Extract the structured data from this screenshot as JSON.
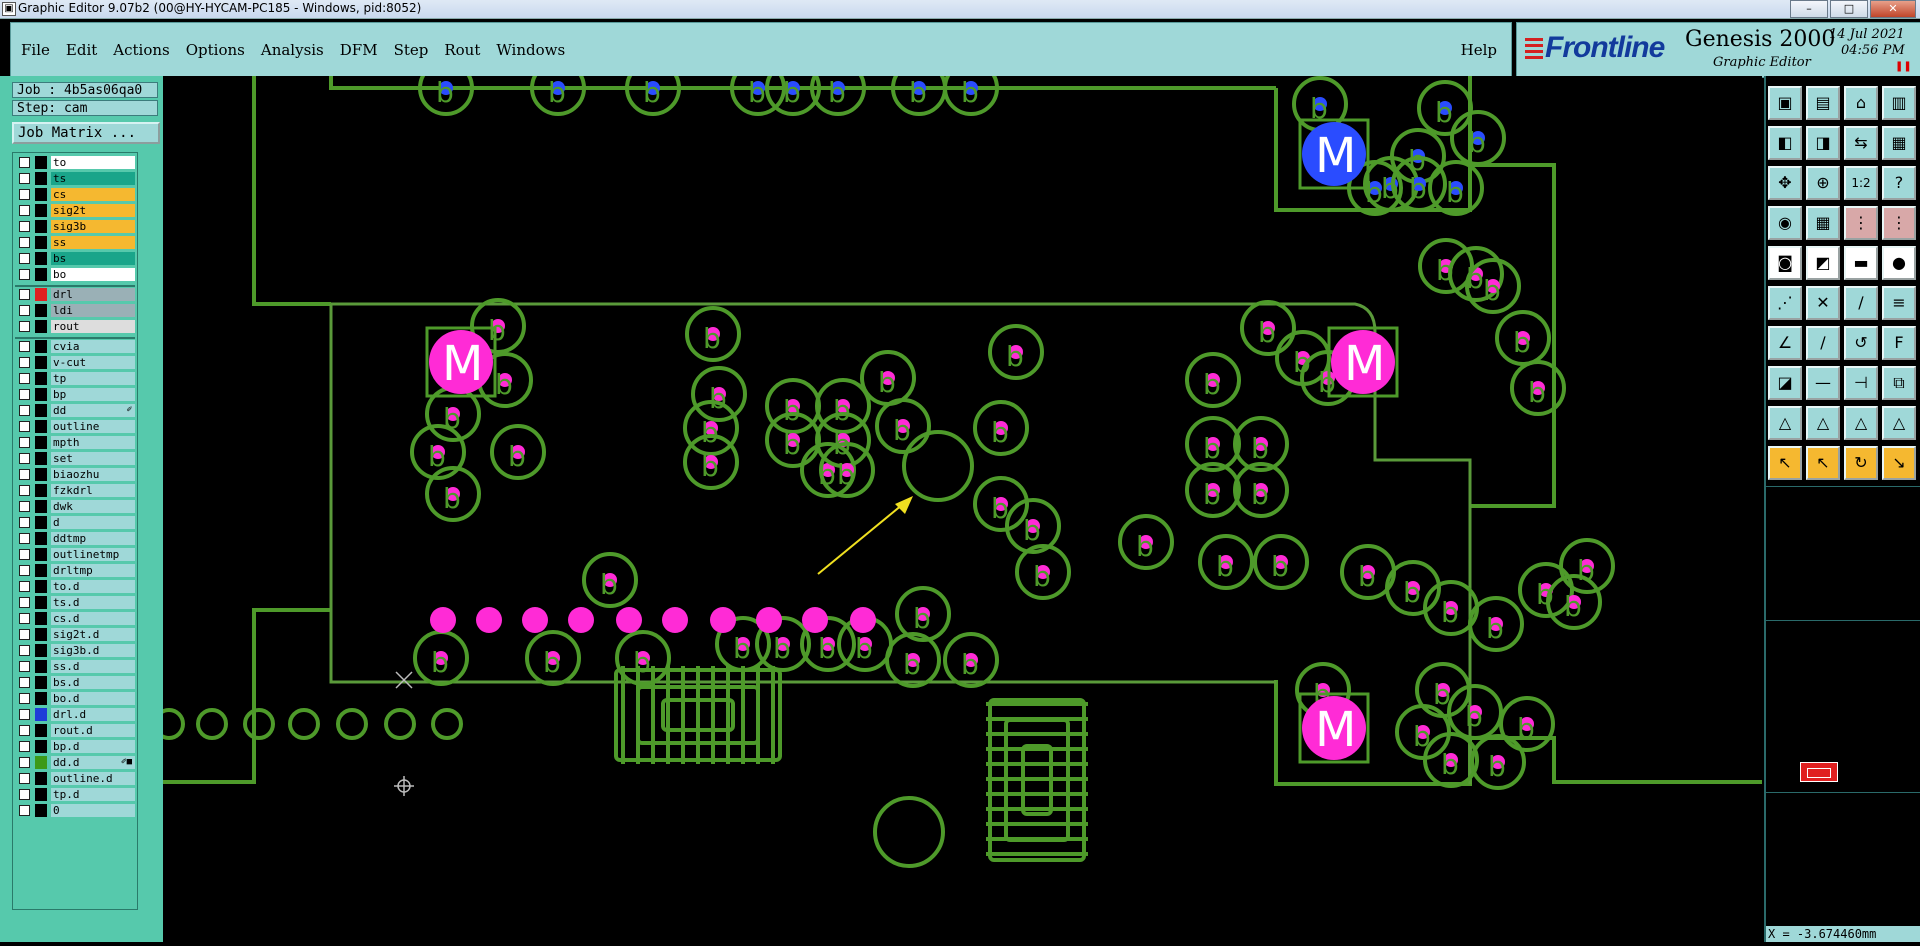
{
  "window": {
    "title": "Graphic Editor 9.07b2 (00@HY-HYCAM-PC185 - Windows, pid:8052)"
  },
  "menubar": {
    "items": [
      "File",
      "Edit",
      "Actions",
      "Options",
      "Analysis",
      "DFM",
      "Step",
      "Rout",
      "Windows"
    ],
    "help": "Help"
  },
  "brand": {
    "logo": "Frontline",
    "product": "Genesis 2000",
    "subtitle": "Graphic Editor",
    "date": "14 Jul 2021",
    "time": "04:56 PM"
  },
  "job": {
    "job_line": "Job : 4b5as06qa0",
    "step_line": "Step: cam",
    "matrix_button": "Job Matrix ..."
  },
  "layers": {
    "board": [
      {
        "name": "to",
        "color": "#ffffff"
      },
      {
        "name": "ts",
        "color": "#1aa58a"
      },
      {
        "name": "cs",
        "color": "#f5b830"
      },
      {
        "name": "sig2t",
        "color": "#f5b830"
      },
      {
        "name": "sig3b",
        "color": "#f5b830"
      },
      {
        "name": "ss",
        "color": "#f5b830"
      },
      {
        "name": "bs",
        "color": "#1aa58a"
      },
      {
        "name": "bo",
        "color": "#ffffff"
      }
    ],
    "drill": [
      {
        "name": "drl",
        "color": "#9ab0b6",
        "swatch": "#e02020"
      },
      {
        "name": "ldi",
        "color": "#9ab0b6"
      },
      {
        "name": "rout",
        "color": "#dddddd"
      }
    ],
    "misc": [
      {
        "name": "cvia"
      },
      {
        "name": "v-cut"
      },
      {
        "name": "tp"
      },
      {
        "name": "bp"
      },
      {
        "name": "dd",
        "mark": "✐"
      },
      {
        "name": "outline"
      },
      {
        "name": "mpth"
      },
      {
        "name": "set"
      },
      {
        "name": "biaozhu"
      },
      {
        "name": "fzkdrl"
      },
      {
        "name": "dwk"
      },
      {
        "name": "d"
      },
      {
        "name": "ddtmp"
      },
      {
        "name": "outlinetmp"
      },
      {
        "name": "drltmp"
      },
      {
        "name": "to.d"
      },
      {
        "name": "ts.d"
      },
      {
        "name": "cs.d"
      },
      {
        "name": "sig2t.d"
      },
      {
        "name": "sig3b.d"
      },
      {
        "name": "ss.d"
      },
      {
        "name": "bs.d"
      },
      {
        "name": "bo.d"
      },
      {
        "name": "drl.d",
        "swatch": "#1e3cd8"
      },
      {
        "name": "rout.d"
      },
      {
        "name": "bp.d"
      },
      {
        "name": "dd.d",
        "swatch": "#3c9a18",
        "mark": "✐■"
      },
      {
        "name": "outline.d"
      },
      {
        "name": "tp.d"
      },
      {
        "name": "0"
      }
    ]
  },
  "canvas": {
    "track_color": "#4e9a2a",
    "pad_color": "#ff2bd6",
    "via_color": "#2a4cff",
    "arrow_color": "#f0e020",
    "mounting_label": "M",
    "pad_label": "b"
  },
  "toolbar": {
    "icons": [
      "open-icon",
      "save-icon",
      "home-icon",
      "window-icon",
      "load-icon",
      "export-icon",
      "swap-icon",
      "panes-icon",
      "fit-icon",
      "zoom-icon",
      "scale-icon",
      "help-icon",
      "snap-icon",
      "grid-icon",
      "layers-icon",
      "layers2-icon",
      "select-icon",
      "draw-icon",
      "measure-icon",
      "pad-icon",
      "node-icon",
      "cross-icon",
      "line-icon",
      "text-icon",
      "angle-icon",
      "slope-icon",
      "arc-icon",
      "font-icon",
      "shape-icon",
      "horiz-icon",
      "fork-icon",
      "group-icon",
      "tri-icon",
      "tri2-icon",
      "tri3-icon",
      "tri4-icon",
      "pointer-icon",
      "pointer2-icon",
      "rotate-icon",
      "route-icon"
    ],
    "glyphs": [
      "▣",
      "▤",
      "⌂",
      "▥",
      "◧",
      "◨",
      "⇆",
      "▦",
      "✥",
      "⊕",
      "1:2",
      "?",
      "◉",
      "▦",
      "⋮",
      "⋮",
      "◙",
      "◩",
      "▬",
      "●",
      "⋰",
      "✕",
      "∕",
      "≡",
      "∠",
      "∕",
      "↺",
      "F",
      "◪",
      "—",
      "⊣",
      "⧉",
      "△",
      "△",
      "△",
      "△",
      "↖",
      "↖",
      "↻",
      "↘"
    ]
  },
  "status": {
    "coordinate": "X = -3.674460mm"
  }
}
